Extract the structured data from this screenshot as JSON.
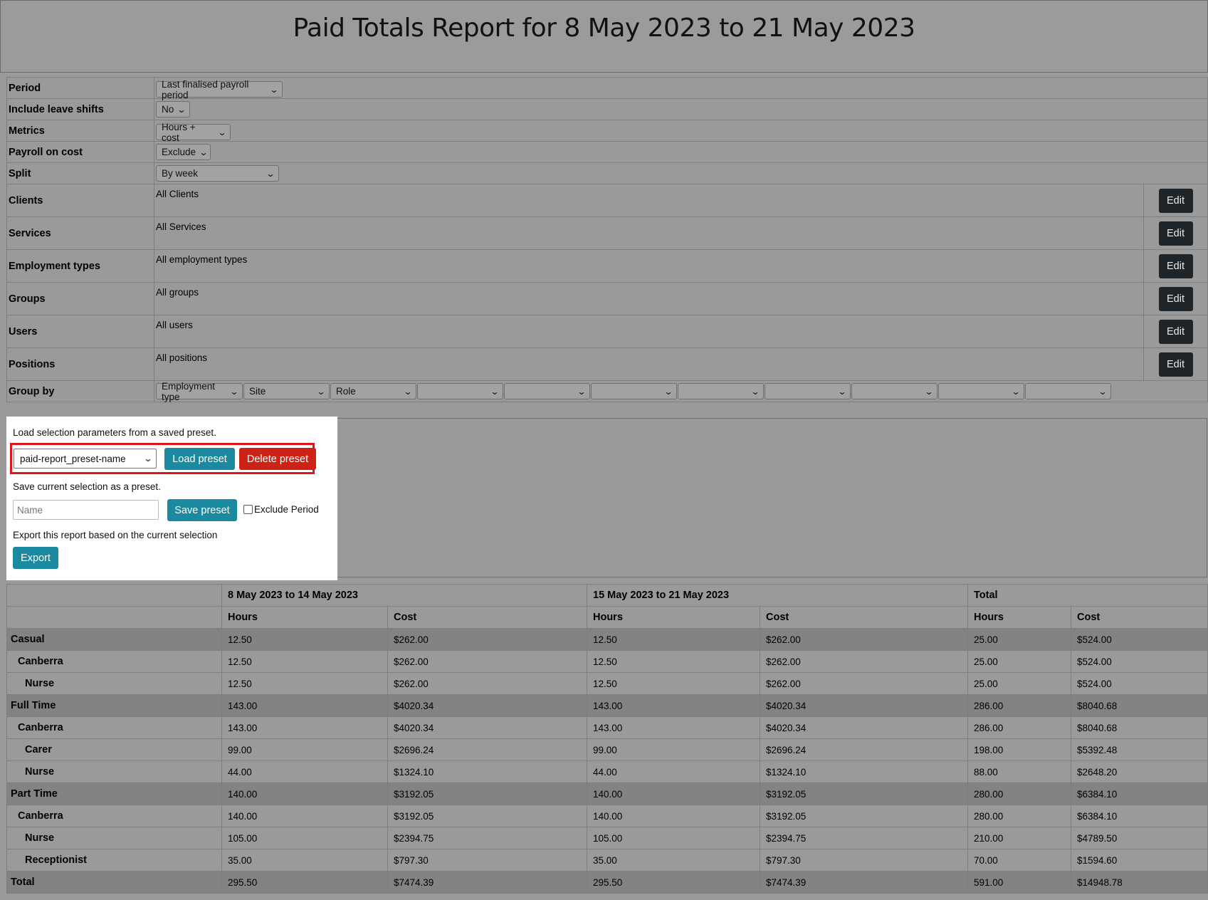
{
  "title": "Paid Totals Report for 8 May 2023 to 21 May 2023",
  "params": {
    "period": {
      "label": "Period",
      "value": "Last finalised payroll period"
    },
    "include_leave": {
      "label": "Include leave shifts",
      "value": "No"
    },
    "metrics": {
      "label": "Metrics",
      "value": "Hours + cost"
    },
    "payroll_on_cost": {
      "label": "Payroll on cost",
      "value": "Exclude"
    },
    "split": {
      "label": "Split",
      "value": "By week"
    },
    "clients": {
      "label": "Clients",
      "value": "All Clients"
    },
    "services": {
      "label": "Services",
      "value": "All Services"
    },
    "employment_types": {
      "label": "Employment types",
      "value": "All employment types"
    },
    "groups": {
      "label": "Groups",
      "value": "All groups"
    },
    "users": {
      "label": "Users",
      "value": "All users"
    },
    "positions": {
      "label": "Positions",
      "value": "All positions"
    },
    "edit_label": "Edit",
    "group_by": {
      "label": "Group by",
      "values": [
        "Employment type",
        "Site",
        "Role",
        "",
        "",
        "",
        "",
        "",
        "",
        "",
        ""
      ]
    }
  },
  "preset": {
    "load_text": "Load selection parameters from a saved preset.",
    "selected": "paid-report_preset-name",
    "load_button": "Load preset",
    "delete_button": "Delete preset",
    "save_text": "Save current selection as a preset.",
    "name_placeholder": "Name",
    "save_button": "Save preset",
    "exclude_period_label": "Exclude Period",
    "export_text": "Export this report based on the current selection",
    "export_button": "Export"
  },
  "results": {
    "periods": [
      "8 May 2023 to 14 May 2023",
      "15 May 2023 to 21 May 2023",
      "Total"
    ],
    "hours_label": "Hours",
    "cost_label": "Cost",
    "rows": [
      {
        "label": "Casual",
        "level": 0,
        "values": [
          "12.50",
          "$262.00",
          "12.50",
          "$262.00",
          "25.00",
          "$524.00"
        ]
      },
      {
        "label": "Canberra",
        "level": 1,
        "values": [
          "12.50",
          "$262.00",
          "12.50",
          "$262.00",
          "25.00",
          "$524.00"
        ]
      },
      {
        "label": "Nurse",
        "level": 2,
        "values": [
          "12.50",
          "$262.00",
          "12.50",
          "$262.00",
          "25.00",
          "$524.00"
        ]
      },
      {
        "label": "Full Time",
        "level": 0,
        "values": [
          "143.00",
          "$4020.34",
          "143.00",
          "$4020.34",
          "286.00",
          "$8040.68"
        ]
      },
      {
        "label": "Canberra",
        "level": 1,
        "values": [
          "143.00",
          "$4020.34",
          "143.00",
          "$4020.34",
          "286.00",
          "$8040.68"
        ]
      },
      {
        "label": "Carer",
        "level": 2,
        "values": [
          "99.00",
          "$2696.24",
          "99.00",
          "$2696.24",
          "198.00",
          "$5392.48"
        ]
      },
      {
        "label": "Nurse",
        "level": 2,
        "values": [
          "44.00",
          "$1324.10",
          "44.00",
          "$1324.10",
          "88.00",
          "$2648.20"
        ]
      },
      {
        "label": "Part Time",
        "level": 0,
        "values": [
          "140.00",
          "$3192.05",
          "140.00",
          "$3192.05",
          "280.00",
          "$6384.10"
        ]
      },
      {
        "label": "Canberra",
        "level": 1,
        "values": [
          "140.00",
          "$3192.05",
          "140.00",
          "$3192.05",
          "280.00",
          "$6384.10"
        ]
      },
      {
        "label": "Nurse",
        "level": 2,
        "values": [
          "105.00",
          "$2394.75",
          "105.00",
          "$2394.75",
          "210.00",
          "$4789.50"
        ]
      },
      {
        "label": "Receptionist",
        "level": 2,
        "values": [
          "35.00",
          "$797.30",
          "35.00",
          "$797.30",
          "70.00",
          "$1594.60"
        ]
      }
    ],
    "total": {
      "label": "Total",
      "values": [
        "295.50",
        "$7474.39",
        "295.50",
        "$7474.39",
        "591.00",
        "$14948.78"
      ]
    }
  },
  "colors": {
    "teal": "#1b8aa0",
    "red": "#cc2316",
    "dark": "#1f2429",
    "highlight": "#e0141b"
  }
}
